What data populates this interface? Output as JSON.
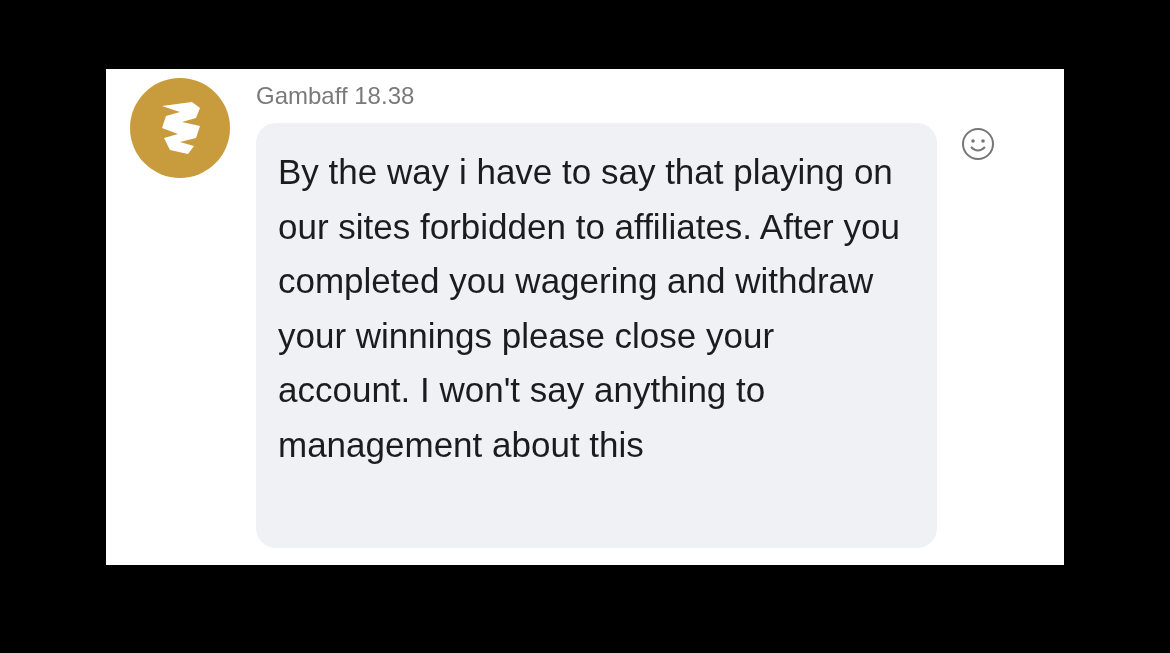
{
  "message": {
    "sender": "Gambaff",
    "time": "18.38",
    "text": "By the way i have to say that playing on our sites forbidden to affiliates. After you completed you wagering and withdraw your winnings please close your account. I won't say anything to management about this"
  }
}
